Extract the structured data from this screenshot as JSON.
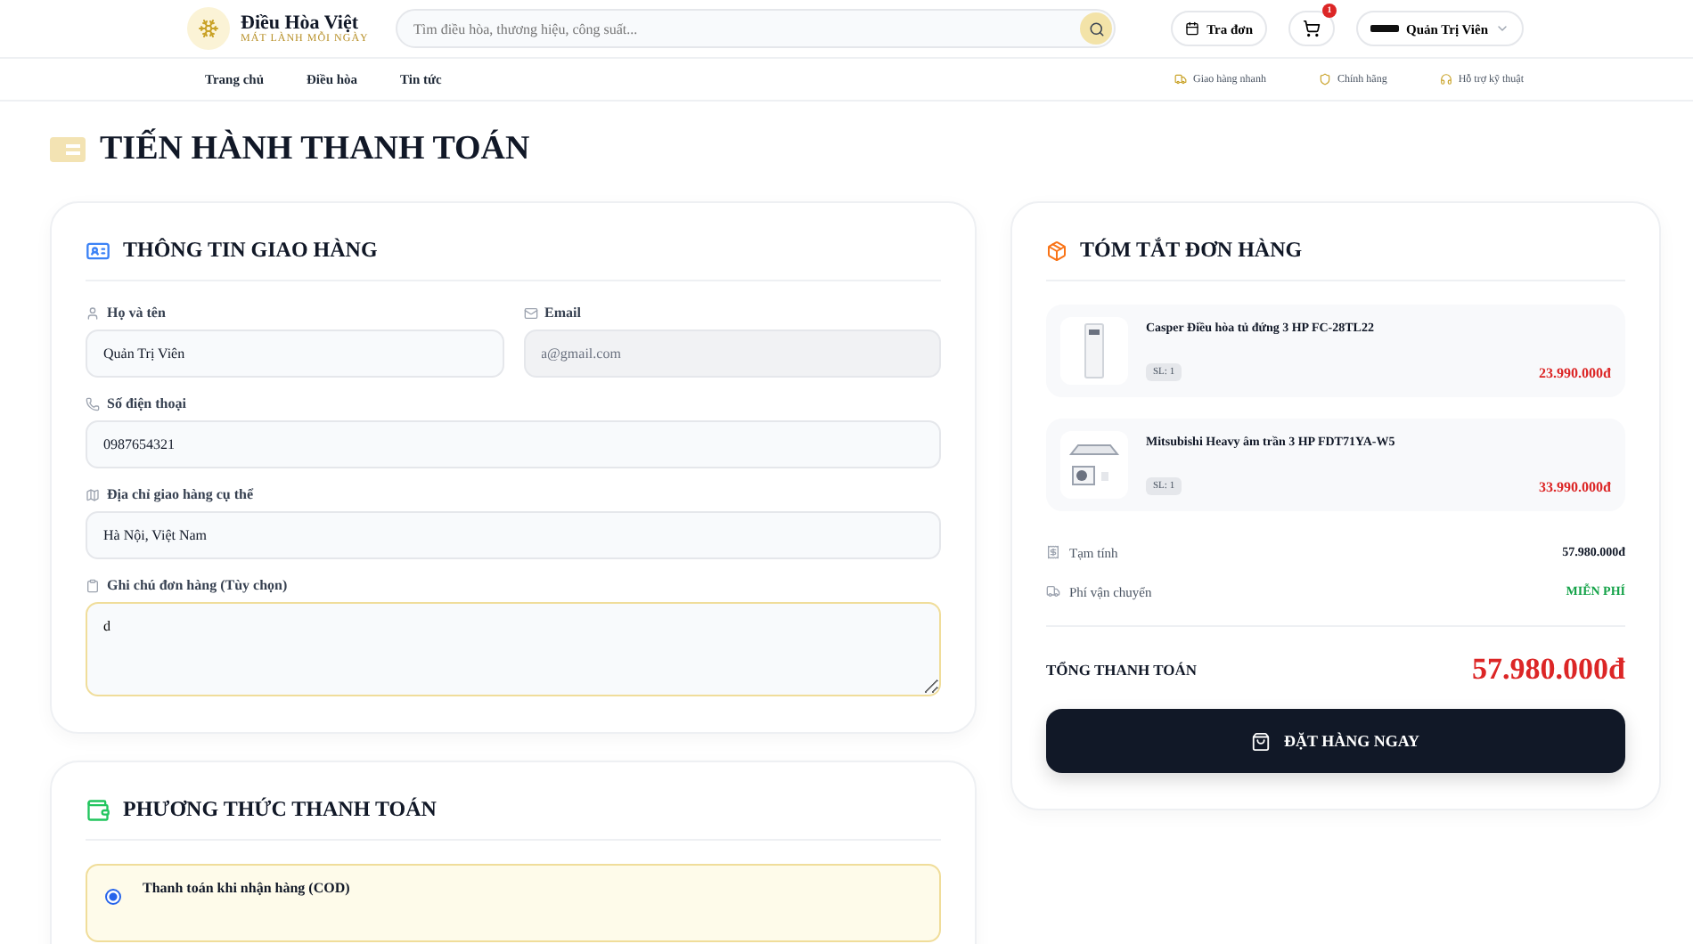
{
  "header": {
    "logo": {
      "name": "Điều Hòa Việt",
      "tagline": "MÁT LÀNH MỖI NGÀY"
    },
    "search": {
      "placeholder": "Tìm điều hòa, thương hiệu, công suất..."
    },
    "track_order": "Tra đơn",
    "cart": {
      "badge": "1"
    },
    "user": {
      "name": "Quản Trị Viên"
    }
  },
  "nav": [
    {
      "label": "Trang chủ"
    },
    {
      "label": "Điều hòa"
    },
    {
      "label": "Tin tức"
    }
  ],
  "features": [
    {
      "label": "Giao hàng nhanh"
    },
    {
      "label": "Chính hãng"
    },
    {
      "label": "Hỗ trợ kỹ thuật"
    }
  ],
  "page_title": "TIẾN HÀNH THANH TOÁN",
  "shipping": {
    "title": "THÔNG TIN GIAO HÀNG",
    "fields": [
      {
        "label": "Họ và tên",
        "value": "Quản Trị Viên",
        "kind": "input",
        "disabled": false,
        "focused": false
      },
      {
        "label": "Email",
        "value": "a@gmail.com",
        "kind": "input",
        "disabled": true,
        "focused": false
      },
      {
        "label": "Số điện thoại",
        "value": "0987654321",
        "kind": "input",
        "disabled": false,
        "focused": false
      },
      {
        "label": "Địa chỉ giao hàng cụ thể",
        "value": "Hà Nội, Việt Nam",
        "kind": "input",
        "disabled": false,
        "focused": false
      },
      {
        "label": "Ghi chú đơn hàng (Tùy chọn)",
        "value": "d",
        "kind": "textarea",
        "disabled": false,
        "focused": true
      }
    ]
  },
  "payment": {
    "title": "PHƯƠNG THỨC THANH TOÁN",
    "options": [
      {
        "label": "Thanh toán khi nhận hàng (COD)",
        "selected": true
      }
    ]
  },
  "summary": {
    "title": "TÓM TẮT ĐƠN HÀNG",
    "items": [
      {
        "name": "Casper Điều hòa tủ đứng 3 HP FC-28TL22",
        "qty": "SL: 1",
        "price": "23.990.000đ",
        "kind": "floor"
      },
      {
        "name": "Mitsubishi Heavy âm trần 3 HP FDT71YA-W5",
        "qty": "SL: 1",
        "price": "33.990.000đ",
        "kind": "ceiling"
      }
    ],
    "rows": [
      {
        "label": "Tạm tính",
        "value": "57.980.000đ",
        "kind": "amount"
      },
      {
        "label": "Phí vận chuyển",
        "value": "MIỄN PHÍ",
        "kind": "free"
      }
    ],
    "total_label": "TỔNG THANH TOÁN",
    "total": "57.980.000đ",
    "button": "ĐẶT HÀNG NGAY"
  }
}
